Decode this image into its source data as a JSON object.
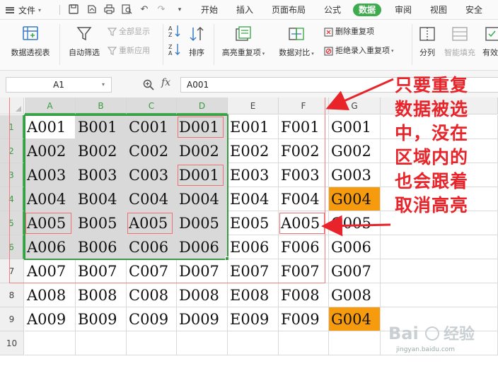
{
  "menubar": {
    "file_label": "文件",
    "tabs": [
      "开始",
      "插入",
      "页面布局",
      "公式",
      "数据",
      "审阅",
      "视图",
      "安全"
    ],
    "active_tab": "数据"
  },
  "ribbon": {
    "pivot_table": "数据透视表",
    "auto_filter": "自动筛选",
    "show_all": "全部显示",
    "reapply": "重新应用",
    "sort": "排序",
    "highlight_duplicates": "高亮重复项",
    "data_compare": "数据对比",
    "delete_duplicates": "删除重复项",
    "reject_duplicates": "拒绝录入重复项",
    "split": "分列",
    "smart_fill": "智能填充",
    "valid": "有效"
  },
  "formula_bar": {
    "name_box": "A1",
    "fx_label": "fx",
    "formula_value": "A001"
  },
  "sheet": {
    "columns": [
      "A",
      "B",
      "C",
      "D",
      "E",
      "F",
      "G"
    ],
    "rows": [
      "1",
      "2",
      "3",
      "4",
      "5",
      "6",
      "7",
      "8",
      "9",
      "10"
    ],
    "cells": [
      [
        "A001",
        "B001",
        "C001",
        "D001",
        "E001",
        "F001",
        "G001"
      ],
      [
        "A002",
        "B002",
        "C002",
        "D002",
        "E002",
        "F002",
        "G002"
      ],
      [
        "A003",
        "B003",
        "C003",
        "D001",
        "E003",
        "F003",
        "G003"
      ],
      [
        "A004",
        "B004",
        "C004",
        "D004",
        "E004",
        "F004",
        "G004"
      ],
      [
        "A005",
        "B005",
        "A005",
        "D005",
        "E005",
        "A005",
        "G005"
      ],
      [
        "A006",
        "B006",
        "C006",
        "D006",
        "E006",
        "F006",
        "G006"
      ],
      [
        "A007",
        "B007",
        "C007",
        "D007",
        "E007",
        "F007",
        "G007"
      ],
      [
        "A008",
        "B008",
        "C008",
        "D008",
        "E008",
        "F008",
        "G008"
      ],
      [
        "A009",
        "B009",
        "C009",
        "D009",
        "E009",
        "F009",
        "G004"
      ],
      [
        "",
        "",
        "",
        "",
        "",
        "",
        ""
      ]
    ],
    "highlight_color": "#f79b0e",
    "selection_color": "#3a9a43"
  },
  "annotation": {
    "lines": [
      "只要重复",
      "数据被选",
      "中，没在",
      "区域内的",
      "也会跟着",
      "取消高亮"
    ],
    "color": "#e8242a"
  },
  "watermark": {
    "text": "jingyan.baidu.com"
  }
}
